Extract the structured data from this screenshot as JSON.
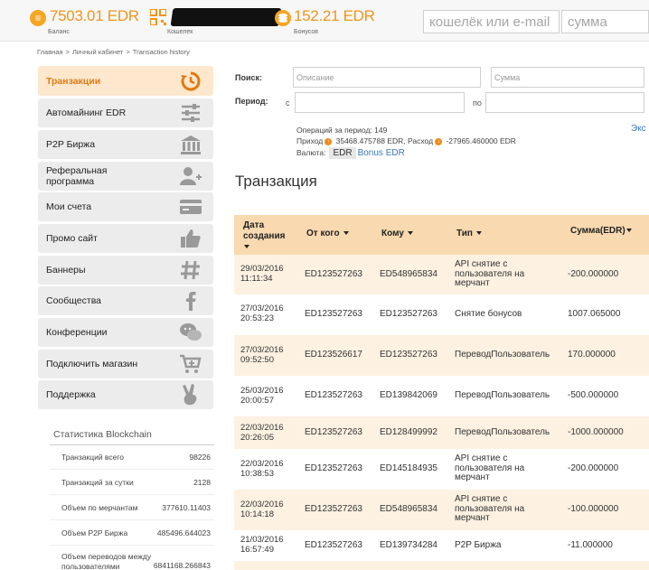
{
  "topbar": {
    "balance_value": "7503.01 EDR",
    "balance_label": "Баланс",
    "wallet_label": "Кошелек",
    "bonus_value": "152.21 EDR",
    "bonus_label": "Бонусов",
    "wallet_search_placeholder": "кошелёк или e-mail",
    "amount_placeholder": "сумма"
  },
  "breadcrumb": [
    "Главная",
    ">",
    "Личный кабинет",
    ">",
    "Transaction history"
  ],
  "sidebar": {
    "items": [
      {
        "label": "Транзакции",
        "icon": "history-icon"
      },
      {
        "label": "Автомайнинг EDR",
        "icon": "sliders-icon"
      },
      {
        "label": "P2P Биржа",
        "icon": "bank-icon"
      },
      {
        "label": "Реферальная\nпрограмма",
        "icon": "add-user-icon"
      },
      {
        "label": "Мои счета",
        "icon": "credit-card-icon"
      },
      {
        "label": "Промо сайт",
        "icon": "thumbs-up-icon"
      },
      {
        "label": "Баннеры",
        "icon": "hashtag-icon"
      },
      {
        "label": "Сообщества",
        "icon": "facebook-icon"
      },
      {
        "label": "Конференции",
        "icon": "chat-icon"
      },
      {
        "label": "Подключить магазин",
        "icon": "cart-add-icon"
      },
      {
        "label": "Поддержка",
        "icon": "victory-hand-icon"
      }
    ]
  },
  "stats": {
    "title": "Статистика Blockchain",
    "rows": [
      {
        "label": "Транзакций всего",
        "value": "98226"
      },
      {
        "label": "Транзакций за сутки",
        "value": "2128"
      },
      {
        "label": "Объем по мерчантам",
        "value": "377610.11403"
      },
      {
        "label": "Объем P2P Биржа",
        "value": "485496.644023"
      },
      {
        "label": "Объем переводов между\nпользователями",
        "value": "6841168.266843"
      }
    ]
  },
  "filter": {
    "search_label": "Поиск:",
    "description_placeholder": "Описание",
    "amount_placeholder": "Сумма",
    "period_label": "Период:",
    "from_label": "с",
    "to_label": "по",
    "ops_text": "Операций за период: 149",
    "income_label": "Приход",
    "income_value": "35468.475788 EDR,",
    "expense_label": "Расход",
    "expense_value": "-27965.460000 EDR",
    "currency_label": "Валюта:",
    "currency_selected": "EDR",
    "currency_alt": "Bonus EDR",
    "export_link": "Экс"
  },
  "section_title": "Транзакция",
  "table": {
    "headers": [
      "Дата\nсоздания",
      "От кого",
      "Кому",
      "Тип",
      "Сумма(EDR)"
    ],
    "rows": [
      {
        "date": "29/03/2016\n11:11:34",
        "from": "ED123527263",
        "to": "ED548965834",
        "type": "API снятие с\nпользователя на\nмерчант",
        "amount": "-200.000000"
      },
      {
        "date": "27/03/2016\n20:53:23",
        "from": "ED123527263",
        "to": "ED123527263",
        "type": "Снятие бонусов",
        "amount": "1007.065000"
      },
      {
        "date": "27/03/2016\n09:52:50",
        "from": "ED123526617",
        "to": "ED123527263",
        "type": "ПереводПользователь",
        "amount": "170.000000"
      },
      {
        "date": "25/03/2016\n20:00:57",
        "from": "ED123527263",
        "to": "ED139842069",
        "type": "ПереводПользователь",
        "amount": "-500.000000"
      },
      {
        "date": "22/03/2016\n20:26:05",
        "from": "ED123527263",
        "to": "ED128499992",
        "type": "ПереводПользователь",
        "amount": "-1000.000000"
      },
      {
        "date": "22/03/2016\n10:38:53",
        "from": "ED123527263",
        "to": "ED145184935",
        "type": "API снятие с\nпользователя на\nмерчант",
        "amount": "-200.000000"
      },
      {
        "date": "22/03/2016\n10:14:18",
        "from": "ED123527263",
        "to": "ED548965834",
        "type": "API снятие с\nпользователя на\nмерчант",
        "amount": "-100.000000"
      },
      {
        "date": "21/03/2016\n16:57:49",
        "from": "ED123527263",
        "to": "ED139734284",
        "type": "P2P Биржа",
        "amount": "-11.000000"
      }
    ]
  },
  "colors": {
    "accent": "#f0941e",
    "header_bg": "#f8d9b0",
    "row_alt": "#fdf1e2",
    "link": "#3a78b8"
  }
}
